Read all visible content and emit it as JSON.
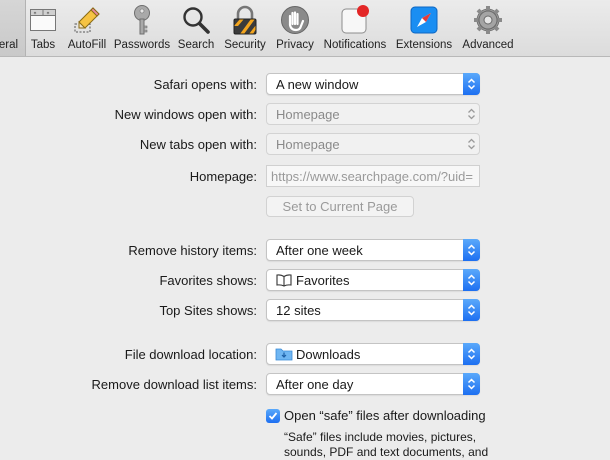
{
  "toolbar": {
    "items": [
      {
        "label": "eral",
        "icon": "general-switch-icon",
        "active": true
      },
      {
        "label": "Tabs",
        "icon": "tabs-icon"
      },
      {
        "label": "AutoFill",
        "icon": "autofill-pencil-icon"
      },
      {
        "label": "Passwords",
        "icon": "key-icon"
      },
      {
        "label": "Search",
        "icon": "magnifier-icon"
      },
      {
        "label": "Security",
        "icon": "padlock-icon"
      },
      {
        "label": "Privacy",
        "icon": "hand-icon"
      },
      {
        "label": "Notifications",
        "icon": "notification-badge-icon"
      },
      {
        "label": "Extensions",
        "icon": "compass-icon"
      },
      {
        "label": "Advanced",
        "icon": "gear-icon"
      }
    ]
  },
  "form": {
    "safari_opens_with": {
      "label": "Safari opens with:",
      "value": "A new window"
    },
    "new_windows_open_with": {
      "label": "New windows open with:",
      "value": "Homepage"
    },
    "new_tabs_open_with": {
      "label": "New tabs open with:",
      "value": "Homepage"
    },
    "homepage": {
      "label": "Homepage:",
      "value": "https://www.searchpage.com/?uid="
    },
    "set_current_page": {
      "label": "Set to Current Page"
    },
    "remove_history": {
      "label": "Remove history items:",
      "value": "After one week"
    },
    "favorites_shows": {
      "label": "Favorites shows:",
      "value": "Favorites"
    },
    "top_sites_shows": {
      "label": "Top Sites shows:",
      "value": "12 sites"
    },
    "download_location": {
      "label": "File download location:",
      "value": "Downloads"
    },
    "remove_download_list": {
      "label": "Remove download list items:",
      "value": "After one day"
    },
    "open_safe_files": {
      "label": "Open “safe” files after downloading",
      "checked": true
    },
    "safe_files_note_line1": "“Safe” files include movies, pictures,",
    "safe_files_note_line2": "sounds, PDF and text documents, and"
  },
  "colors": {
    "accent": "#1d6ff1",
    "window_bg": "#ececec"
  }
}
